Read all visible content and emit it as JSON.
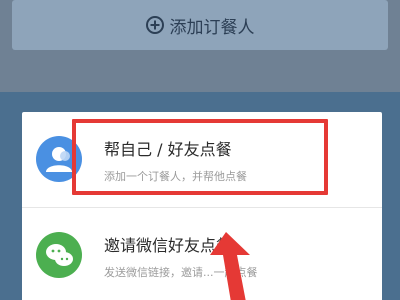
{
  "header": {
    "add_button_label": "添加订餐人"
  },
  "options": [
    {
      "title": "帮自己 / 好友点餐",
      "subtitle": "添加一个订餐人，并帮他点餐"
    },
    {
      "title": "邀请微信好友点餐",
      "subtitle": "发送微信链接，邀请...一起点餐"
    }
  ],
  "colors": {
    "highlight": "#e53935",
    "arrow": "#e53935",
    "option1_icon_bg": "#4a90e2",
    "option2_icon_bg": "#4caf50"
  },
  "icons": {
    "option1": "person-icon",
    "option2": "wechat-icon"
  }
}
